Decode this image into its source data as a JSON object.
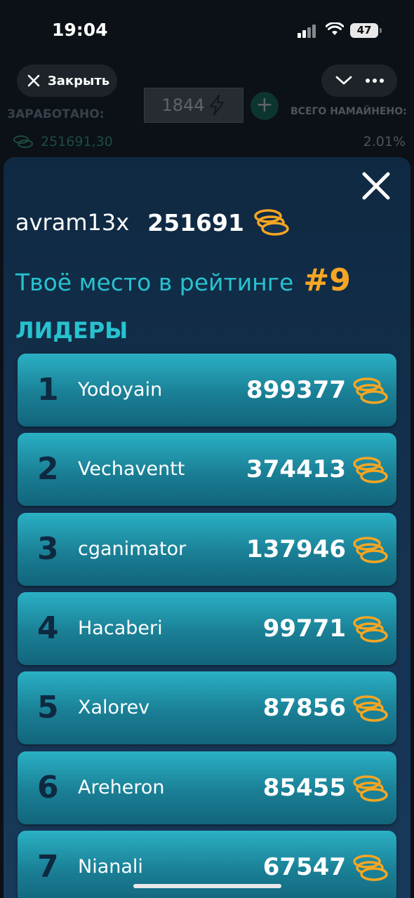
{
  "status": {
    "time": "19:04",
    "battery": "47"
  },
  "app_header": {
    "close_label": "Закрыть"
  },
  "background_app": {
    "earned_label": "ЗАРАБОТАНО:",
    "energy_value": "1844",
    "mined_label": "ВСЕГО НАМАЙНЕНО:",
    "earned_value": "251691,30",
    "mined_value": "2.01%"
  },
  "modal": {
    "username": "avram13x",
    "score": "251691",
    "rank_label": "Твоё место в рейтинге",
    "rank_value": "#9",
    "leaders_title": "ЛИДЕРЫ",
    "leaders": [
      {
        "rank": "1",
        "name": "Yodoyain",
        "score": "899377"
      },
      {
        "rank": "2",
        "name": "Vechaventt",
        "score": "374413"
      },
      {
        "rank": "3",
        "name": "cganimator",
        "score": "137946"
      },
      {
        "rank": "4",
        "name": "Hacaberi",
        "score": "99771"
      },
      {
        "rank": "5",
        "name": "Xalorev",
        "score": "87856"
      },
      {
        "rank": "6",
        "name": "Areheron",
        "score": "85455"
      },
      {
        "rank": "7",
        "name": "Nianali",
        "score": "67547"
      }
    ]
  },
  "colors": {
    "accent_cyan": "#27c2cf",
    "accent_orange": "#f5a623",
    "modal_bg": "#0f2942"
  }
}
